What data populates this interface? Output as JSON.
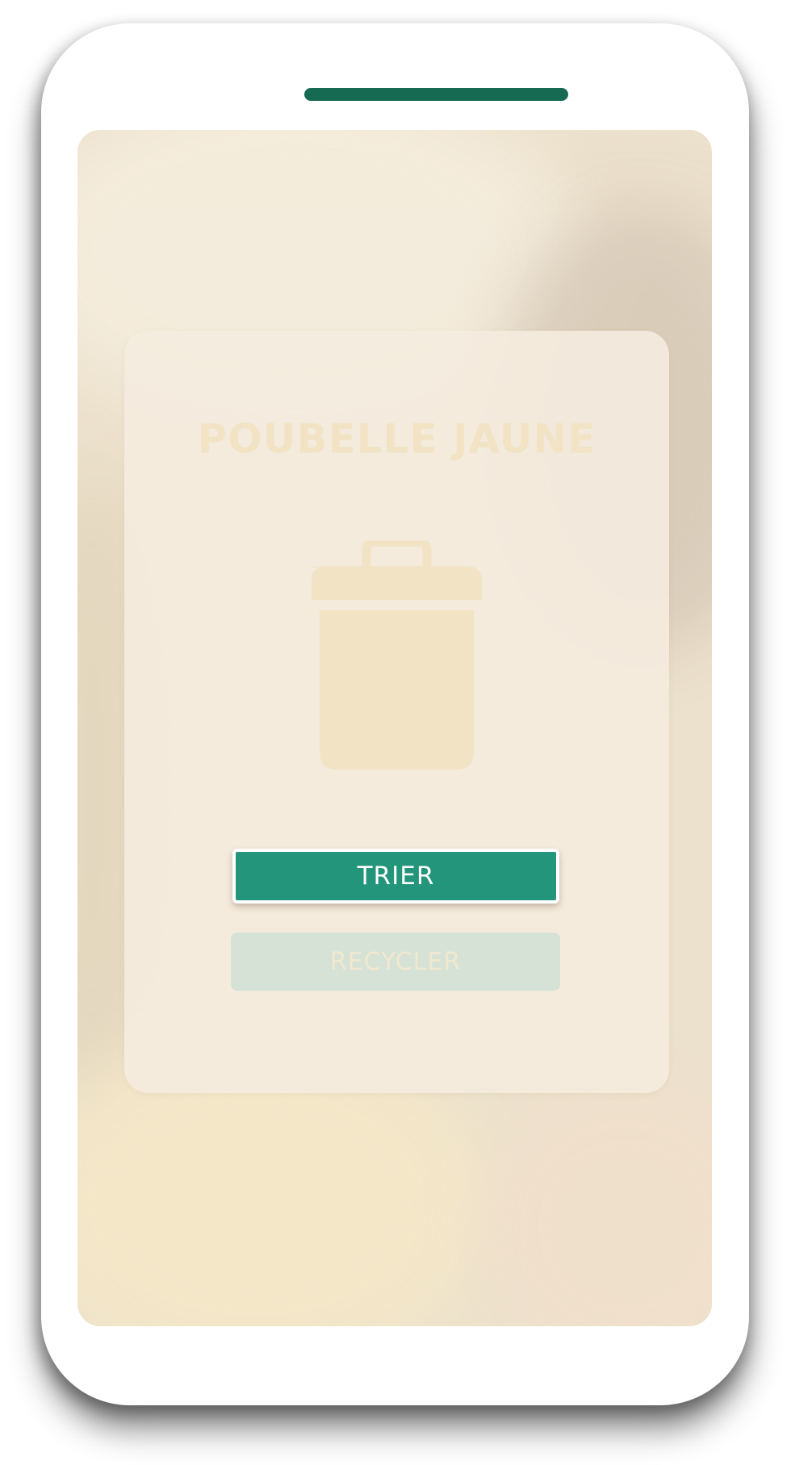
{
  "card": {
    "title": "POUBELLE JAUNE",
    "icon": "trash-bin-icon"
  },
  "buttons": {
    "primary_label": "TRIER",
    "secondary_label": "RECYCLER"
  },
  "colors": {
    "accent": "#22957a",
    "speaker": "#176a52",
    "title_text": "#f1e3c4",
    "bin_fill": "#f3e3c5",
    "secondary_button_bg": "#d6e2d6"
  }
}
